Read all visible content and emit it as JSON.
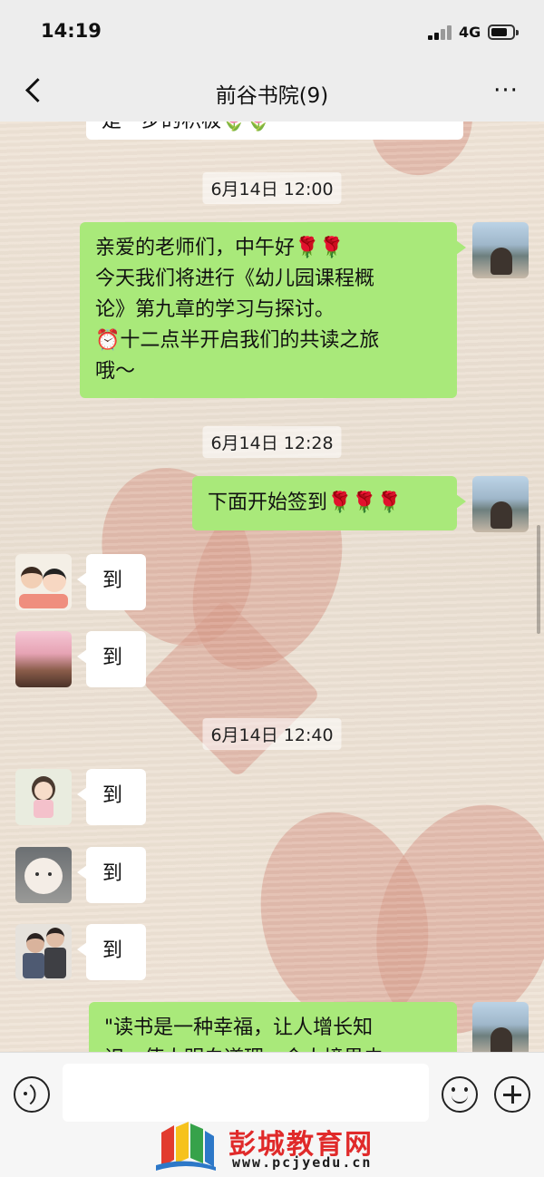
{
  "status_bar": {
    "time": "14:19",
    "network": "4G"
  },
  "nav": {
    "title": "前谷书院(9)",
    "more": "···"
  },
  "chat": {
    "top_partial": "是一步的积极🌷🌷",
    "timestamps": [
      "6月14日 12:00",
      "6月14日 12:28",
      "6月14日 12:40"
    ],
    "msg_intro": {
      "lines": [
        "亲爱的老师们，中午好🌹🌹",
        "今天我们将进行《幼儿园课程概",
        "论》第九章的学习与探讨。",
        "⏰十二点半开启我们的共读之旅",
        "哦～"
      ]
    },
    "msg_signin": "下面开始签到🌹🌹🌹",
    "replies": [
      "到",
      "到",
      "到",
      "到",
      "到"
    ],
    "msg_quote": {
      "lines": [
        "\"读书是一种幸福，让人增长知",
        "识，使人明白道理，会人境界去"
      ]
    }
  },
  "watermark": {
    "title": "彭城教育网",
    "url": "www.pcjyedu.cn"
  },
  "colors": {
    "self_bubble": "#a9e97a",
    "other_bubble": "#ffffff",
    "title_red": "#e02a2a"
  }
}
